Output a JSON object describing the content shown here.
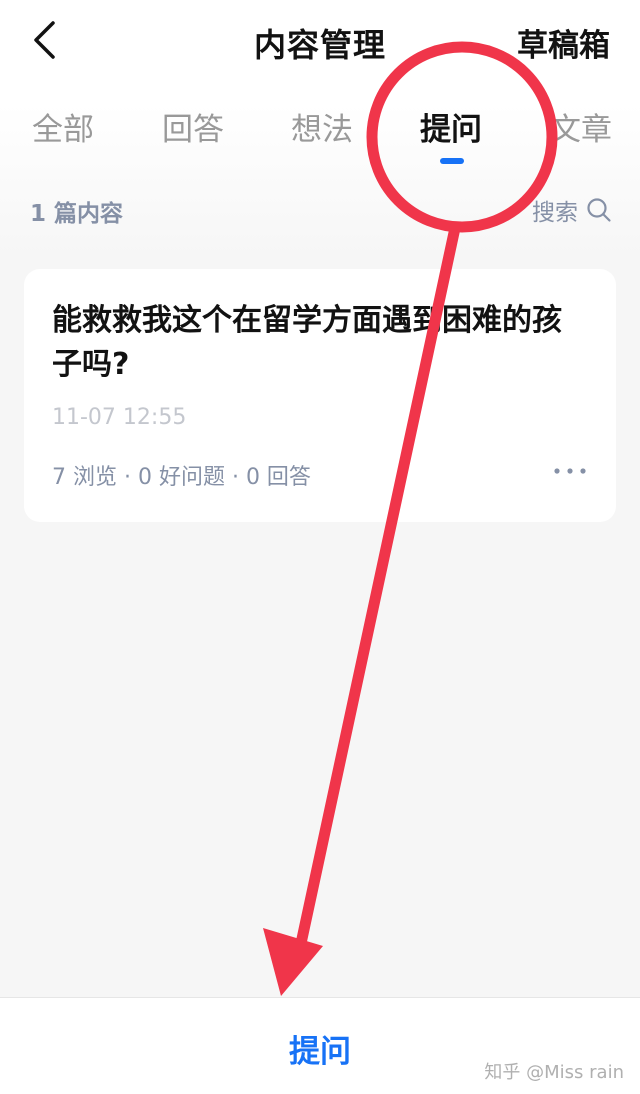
{
  "header": {
    "title": "内容管理",
    "drafts_label": "草稿箱"
  },
  "tabs": [
    {
      "label": "全部"
    },
    {
      "label": "回答"
    },
    {
      "label": "想法"
    },
    {
      "label": "提问",
      "active": true
    },
    {
      "label": "文章"
    }
  ],
  "content_count": "1 篇内容",
  "search_label": "搜索",
  "question": {
    "title": "能救救我这个在留学方面遇到困难的孩子吗?",
    "time": "11-07 12:55",
    "stats": "7 浏览 · 0 好问题 · 0 回答"
  },
  "bottom_bar": {
    "ask_label": "提问"
  },
  "watermark": "知乎 @Miss rain",
  "colors": {
    "accent": "#1772f6",
    "annotation": "#f0354a"
  },
  "icons": {
    "back": "back-arrow-icon",
    "search": "search-icon",
    "more": "more-dots-icon"
  }
}
